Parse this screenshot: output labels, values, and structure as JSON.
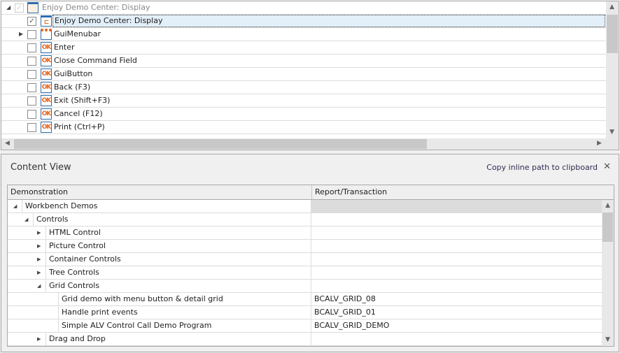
{
  "tree": {
    "root": {
      "label": "Enjoy Demo Center: Display",
      "checked": true,
      "disabled": true,
      "expanded": true
    },
    "items": [
      {
        "label": "Enjoy Demo Center: Display",
        "checked": true,
        "icon": "screen-icon",
        "selected": true
      },
      {
        "label": "GuiMenubar",
        "checked": false,
        "icon": "menubar-icon",
        "expandable": true
      },
      {
        "label": "Enter",
        "checked": false,
        "icon": "ok-button-icon"
      },
      {
        "label": "Close Command Field",
        "checked": false,
        "icon": "ok-button-icon"
      },
      {
        "label": "GuiButton",
        "checked": false,
        "icon": "ok-button-icon"
      },
      {
        "label": "Back (F3)",
        "checked": false,
        "icon": "ok-button-icon"
      },
      {
        "label": "Exit (Shift+F3)",
        "checked": false,
        "icon": "ok-button-icon"
      },
      {
        "label": "Cancel (F12)",
        "checked": false,
        "icon": "ok-button-icon"
      },
      {
        "label": "Print (Ctrl+P)",
        "checked": false,
        "icon": "ok-button-icon"
      }
    ],
    "icon_text": "OK"
  },
  "content_view": {
    "title": "Content View",
    "copy_label": "Copy inline path to clipboard",
    "columns": [
      "Demonstration",
      "Report/Transaction"
    ],
    "rows": [
      {
        "label": "Workbench Demos",
        "level": 0,
        "state": "expanded",
        "report": ""
      },
      {
        "label": "Controls",
        "level": 1,
        "state": "expanded",
        "report": ""
      },
      {
        "label": "HTML Control",
        "level": 2,
        "state": "collapsed",
        "report": ""
      },
      {
        "label": "Picture Control",
        "level": 2,
        "state": "collapsed",
        "report": ""
      },
      {
        "label": "Container Controls",
        "level": 2,
        "state": "collapsed",
        "report": ""
      },
      {
        "label": "Tree Controls",
        "level": 2,
        "state": "collapsed",
        "report": ""
      },
      {
        "label": "Grid Controls",
        "level": 2,
        "state": "expanded",
        "report": ""
      },
      {
        "label": "Grid demo with menu button & detail grid",
        "level": 3,
        "state": "leaf",
        "report": "BCALV_GRID_08"
      },
      {
        "label": "Handle print events",
        "level": 3,
        "state": "leaf",
        "report": "BCALV_GRID_01"
      },
      {
        "label": "Simple ALV Control Call Demo Program",
        "level": 3,
        "state": "leaf",
        "report": "BCALV_GRID_DEMO"
      },
      {
        "label": "Drag and Drop",
        "level": 2,
        "state": "collapsed",
        "report": ""
      }
    ]
  }
}
